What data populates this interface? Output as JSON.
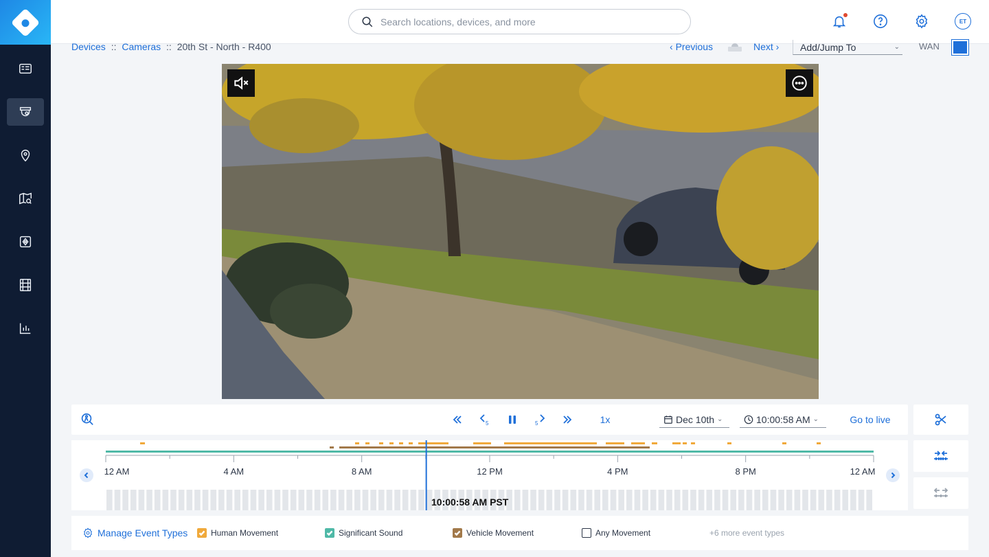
{
  "search": {
    "placeholder": "Search locations, devices, and more"
  },
  "header": {
    "avatar_initials": "ET",
    "icons": [
      "bell-icon",
      "help-icon",
      "gear-icon"
    ]
  },
  "sidebar": {
    "items": [
      {
        "name": "dashboard",
        "icon": "dashboard-icon"
      },
      {
        "name": "cameras",
        "icon": "camera-icon",
        "active": true
      },
      {
        "name": "locations",
        "icon": "pin-icon"
      },
      {
        "name": "map",
        "icon": "map-search-icon"
      },
      {
        "name": "access",
        "icon": "access-icon"
      },
      {
        "name": "media",
        "icon": "film-icon"
      },
      {
        "name": "analytics",
        "icon": "chart-icon"
      }
    ]
  },
  "breadcrumb": {
    "devices": "Devices",
    "cameras": "Cameras",
    "sep": "::",
    "current": "20th St - North - R400"
  },
  "nav": {
    "previous": "Previous",
    "next": "Next",
    "jump": "Add/Jump To",
    "wan": "WAN"
  },
  "controls": {
    "speed": "1x",
    "date": "Dec 10th",
    "time": "10:00:58 AM",
    "go_live": "Go to live"
  },
  "timeline": {
    "ticks": [
      "12 AM",
      "4 AM",
      "8 AM",
      "12 PM",
      "4 PM",
      "8 PM",
      "12 AM"
    ],
    "current_label": "10:00:58 AM PST",
    "current_fraction_of_day": 0.4174
  },
  "legend": {
    "manage": "Manage Event Types",
    "types": [
      {
        "label": "Human Movement",
        "color": "#f0a93b",
        "checked": true
      },
      {
        "label": "Significant Sound",
        "color": "#4fb9a7",
        "checked": true
      },
      {
        "label": "Vehicle Movement",
        "color": "#a2794a",
        "checked": true
      },
      {
        "label": "Any Movement",
        "color": "#ffffff",
        "checked": false
      }
    ],
    "more": "+6 more event types"
  },
  "colors": {
    "accent": "#1e6fd9",
    "sidebar": "#0f1c33",
    "human": "#f0a93b",
    "sound": "#4fb9a7",
    "vehicle": "#a2794a"
  }
}
